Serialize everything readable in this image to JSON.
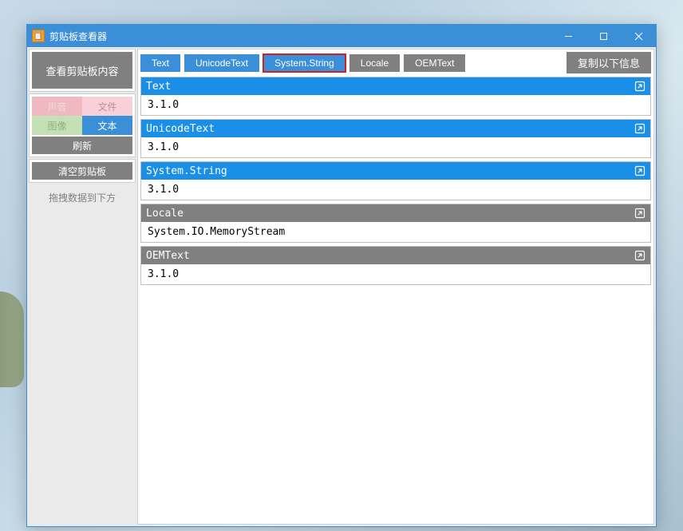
{
  "window": {
    "title": "剪贴板查看器"
  },
  "sidebar": {
    "view_btn": "查看剪贴板内容",
    "tags": {
      "sound": "声音",
      "file": "文件",
      "image": "图像",
      "text": "文本"
    },
    "refresh_btn": "刷新",
    "clear_btn": "清空剪贴板",
    "drag_hint": "拖拽数据到下方"
  },
  "toolbar": {
    "tabs": [
      {
        "label": "Text",
        "state": "active"
      },
      {
        "label": "UnicodeText",
        "state": "active"
      },
      {
        "label": "System.String",
        "state": "selected"
      },
      {
        "label": "Locale",
        "state": "normal"
      },
      {
        "label": "OEMText",
        "state": "normal"
      }
    ],
    "copy_btn": "复制以下信息"
  },
  "entries": [
    {
      "name": "Text",
      "value": "3.1.0",
      "style": "primary"
    },
    {
      "name": "UnicodeText",
      "value": "3.1.0",
      "style": "primary"
    },
    {
      "name": "System.String",
      "value": "3.1.0",
      "style": "primary"
    },
    {
      "name": "Locale",
      "value": "System.IO.MemoryStream",
      "style": "secondary"
    },
    {
      "name": "OEMText",
      "value": "3.1.0",
      "style": "secondary"
    }
  ]
}
